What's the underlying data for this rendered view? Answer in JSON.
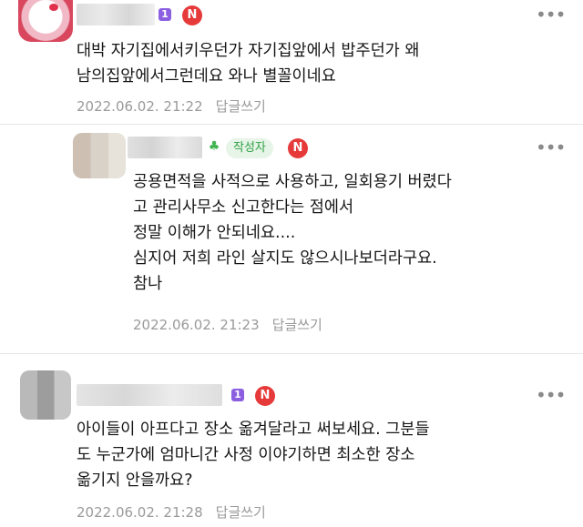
{
  "comments": [
    {
      "level_badge": "1",
      "n_badge": "N",
      "text": "대박 자기집에서키우던가 자기집앞에서 밥주던가 왜\n남의집앞에서그런데요 와나 별꼴이네요",
      "date": "2022.06.02. 21:22",
      "reply_label": "답글쓰기",
      "more_label": "•••"
    },
    {
      "author_badge": "작성자",
      "n_badge": "N",
      "text": "공용면적을 사적으로 사용하고, 일회용기 버렸다\n고 관리사무소 신고한다는 점에서\n정말 이해가 안되네요....\n심지어 저희 라인 살지도 않으시나보더라구요.\n참나",
      "date": "2022.06.02. 21:23",
      "reply_label": "답글쓰기",
      "more_label": "•••"
    },
    {
      "level_badge": "1",
      "n_badge": "N",
      "text": "아이들이 아프다고 장소 옮겨달라고 써보세요. 그분들\n도 누군가에 엄마니간 사정 이야기하면 최소한 장소\n옮기지 안을까요?",
      "date": "2022.06.02. 21:28",
      "reply_label": "답글쓰기",
      "more_label": "•••"
    }
  ],
  "icons": {
    "sprout": "sprout-icon",
    "more": "more-dots-icon"
  },
  "colors": {
    "level_badge": "#8c5fe0",
    "n_badge": "#e63a3a",
    "author_badge_bg": "#e6f5e8",
    "author_badge_text": "#31a045",
    "meta_text": "#9a9a9a"
  }
}
